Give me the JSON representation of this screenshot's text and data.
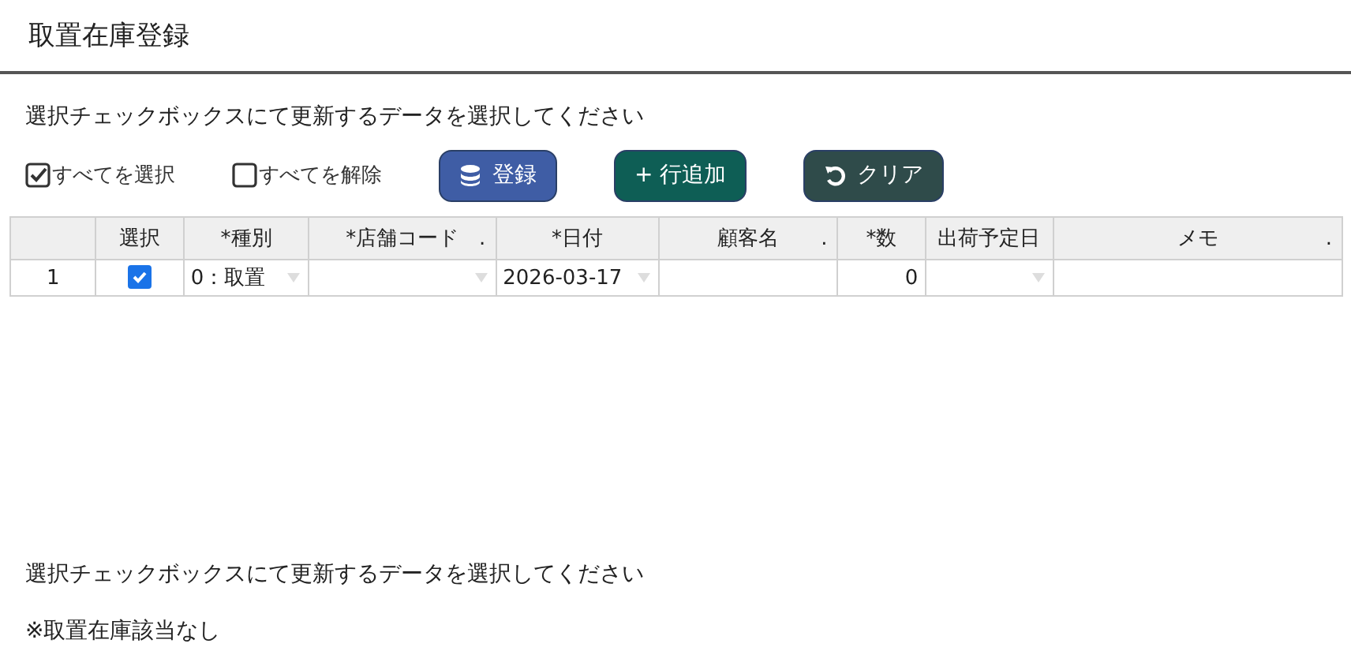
{
  "page_title": "取置在庫登録",
  "instruction": "選択チェックボックスにて更新するデータを選択してください",
  "toolbar": [
    {
      "kind": "check",
      "label": "すべてを選択",
      "checked": true
    },
    {
      "kind": "check",
      "label": "すべてを解除",
      "checked": false
    },
    {
      "kind": "button",
      "label": "登録",
      "color": "#3f5da5"
    },
    {
      "kind": "button",
      "label": "+ 行追加",
      "color": "#0e5e55"
    },
    {
      "kind": "button",
      "label": "クリア",
      "color": "#2f4b4a"
    }
  ],
  "table": {
    "columns": [
      {},
      {
        "label": "選択"
      },
      {
        "label": "*種別"
      },
      {
        "label": "*店舗コード",
        "marker": "."
      },
      {
        "label": "*日付"
      },
      {
        "label": "顧客名",
        "marker": "."
      },
      {
        "label": "*数"
      },
      {
        "label": "出荷予定日"
      },
      {
        "label": "メモ",
        "marker": "."
      }
    ],
    "rows": [
      {
        "cells": [
          {
            "kind": "rownum",
            "text": "1"
          },
          {
            "kind": "checkbox",
            "checked": true
          },
          {
            "kind": "select",
            "text": "0：取置"
          },
          {
            "kind": "select"
          },
          {
            "kind": "select",
            "text": "2026-03-17"
          },
          {
            "kind": "text"
          },
          {
            "kind": "number",
            "text": "0"
          },
          {
            "kind": "select"
          },
          {
            "kind": "text"
          }
        ]
      }
    ]
  },
  "footer_instruction": "選択チェックボックスにて更新するデータを選択してください",
  "notice": "※取置在庫該当なし"
}
